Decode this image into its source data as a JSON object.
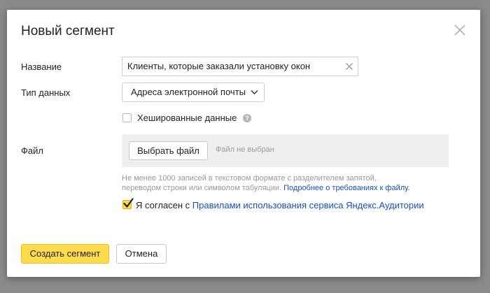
{
  "dialog": {
    "title": "Новый сегмент"
  },
  "form": {
    "name_label": "Название",
    "name_value": "Клиенты, которые заказали установку окон",
    "data_type_label": "Тип данных",
    "data_type_value": "Адреса электронной почты",
    "hashed_label": "Хешированные данные",
    "hashed_checked": false,
    "file_label": "Файл",
    "file_button": "Выбрать файл",
    "file_status": "Файл не выбран",
    "hint_text_line1": "Не менее 1000 записей в текстовом формате с разделителем запятой,",
    "hint_text_line2": "переводом строки или символом табуляции.",
    "hint_link": "Подробнее о требованиях к файлу.",
    "agree_prefix": "Я согласен с",
    "agree_link": "Правилами использования сервиса Яндекс.Аудитории",
    "agree_checked": true
  },
  "buttons": {
    "create": "Создать сегмент",
    "cancel": "Отмена"
  },
  "colors": {
    "accent": "#ffdb4d",
    "link": "#1a4fb5",
    "muted": "#999999"
  },
  "icons": {
    "close": "close-icon",
    "clear": "clear-icon",
    "chevron": "chevron-down-icon",
    "help": "help-icon",
    "check": "check-icon"
  }
}
